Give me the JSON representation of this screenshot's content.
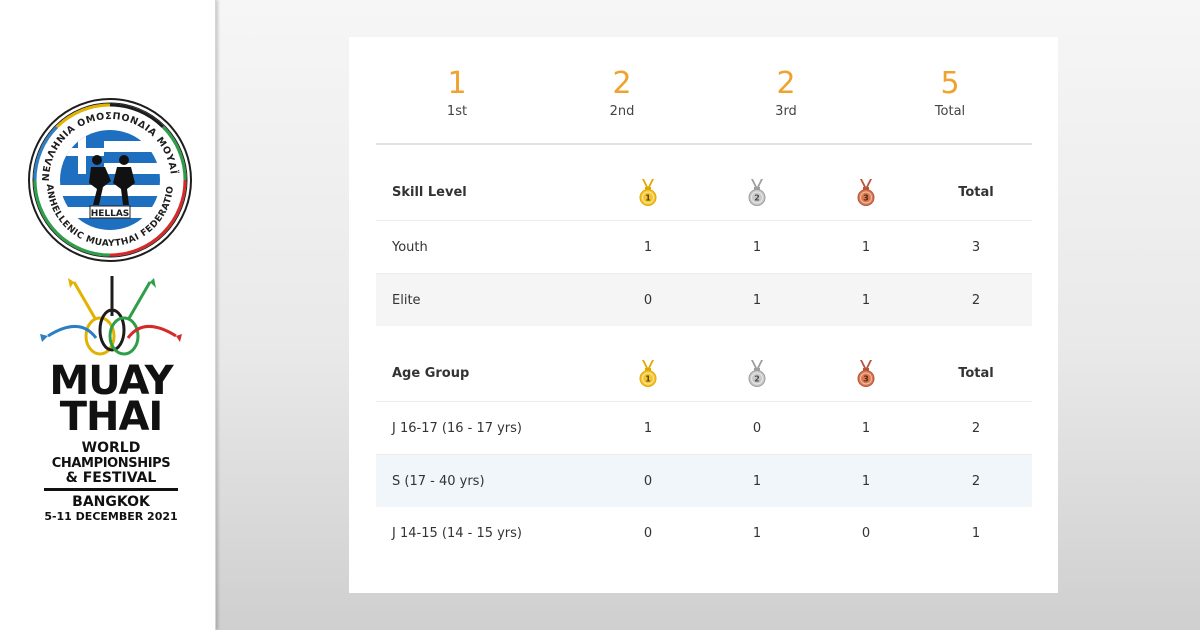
{
  "sidebar": {
    "seal": {
      "arc_top": "ΠΑΝΕΛΛΗΝΙΑ ΟΜΟΣΠΟΝΔΙΑ ΜΟΥΑΪ ΤΑΪ",
      "arc_bottom": "PANHELLENIC MUAYTHAI FEDERATION",
      "center": "HELLAS"
    },
    "event": {
      "line1": "MUAY",
      "line2": "THAI",
      "line3": "WORLD",
      "line4": "CHAMPIONSHIPS",
      "line5": "& FESTIVAL",
      "line6": "BANGKOK",
      "line7": "5-11 DECEMBER 2021"
    }
  },
  "summary": [
    {
      "value": "1",
      "label": "1st"
    },
    {
      "value": "2",
      "label": "2nd"
    },
    {
      "value": "2",
      "label": "3rd"
    },
    {
      "value": "5",
      "label": "Total"
    }
  ],
  "skill_table": {
    "header": {
      "label": "Skill Level",
      "total": "Total"
    },
    "rows": [
      {
        "label": "Youth",
        "gold": "1",
        "silver": "1",
        "bronze": "1",
        "total": "3"
      },
      {
        "label": "Elite",
        "gold": "0",
        "silver": "1",
        "bronze": "1",
        "total": "2"
      }
    ]
  },
  "age_table": {
    "header": {
      "label": "Age Group",
      "total": "Total"
    },
    "rows": [
      {
        "label": "J 16-17 (16 - 17 yrs)",
        "gold": "1",
        "silver": "0",
        "bronze": "1",
        "total": "2"
      },
      {
        "label": "S (17 - 40 yrs)",
        "gold": "0",
        "silver": "1",
        "bronze": "1",
        "total": "2"
      },
      {
        "label": "J 14-15 (14 - 15 yrs)",
        "gold": "0",
        "silver": "1",
        "bronze": "0",
        "total": "1"
      }
    ]
  },
  "medals": {
    "gold": {
      "icon": "gold-medal-icon",
      "number": "1",
      "color": "#f4c430",
      "ribbon": "#e0a800"
    },
    "silver": {
      "icon": "silver-medal-icon",
      "number": "2",
      "color": "#c9c9c9",
      "ribbon": "#9e9e9e"
    },
    "bronze": {
      "icon": "bronze-medal-icon",
      "number": "3",
      "color": "#d9794f",
      "ribbon": "#b5553a"
    }
  },
  "colors": {
    "accent": "#f0a22e"
  }
}
